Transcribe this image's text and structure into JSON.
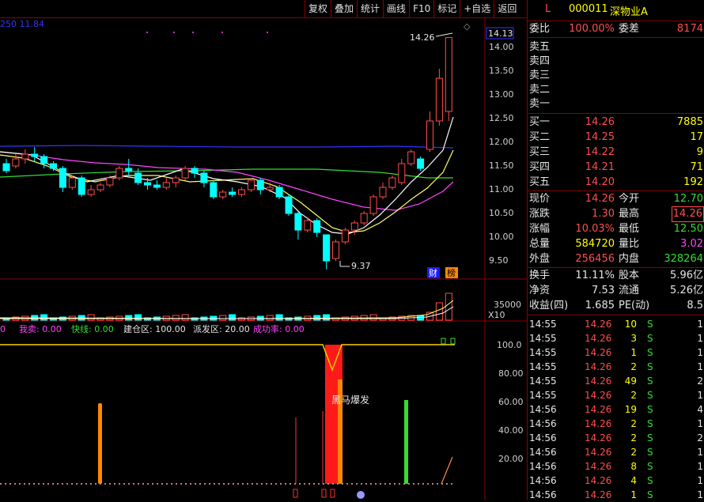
{
  "toolbar": {
    "buttons": [
      "复权",
      "叠加",
      "统计",
      "画线",
      "F10",
      "标记",
      "+自选",
      "返回"
    ]
  },
  "main_chart": {
    "ma_label": "250  11.84",
    "price_labels": [
      "14.00",
      "13.50",
      "13.00",
      "12.50",
      "12.00",
      "11.50",
      "11.00",
      "10.50",
      "10.00",
      "9.50"
    ],
    "current_price_tag": "14.13",
    "high_annotation": "14.26",
    "low_annotation": "9.37",
    "badge_cai": "财",
    "badge_bang": "榜"
  },
  "volume": {
    "label": "35000",
    "multiplier": "X10"
  },
  "indicator": {
    "labels": [
      {
        "text": "我卖: 0.00",
        "color": "#ff44ff"
      },
      {
        "text": "快线: 0.00",
        "color": "#33dd33"
      },
      {
        "text": "建仓区: 100.00",
        "color": "#e6e6e6"
      },
      {
        "text": "派发区: 20.00",
        "color": "#e6e6e6"
      },
      {
        "text": "成功率: 0.00",
        "color": "#ff44ff"
      }
    ],
    "left_stub": "0",
    "y_labels": [
      "100.0",
      "80.00",
      "60.00",
      "40.00",
      "20.00"
    ],
    "annotation": "黑马爆发"
  },
  "stock": {
    "marker": "L",
    "code": "000011",
    "name": "深物业A"
  },
  "order_book": {
    "weibi_label": "委比",
    "weibi_value": "100.00%",
    "weicha_label": "委差",
    "weicha_value": "8174",
    "asks": [
      {
        "label": "卖五"
      },
      {
        "label": "卖四"
      },
      {
        "label": "卖三"
      },
      {
        "label": "卖二"
      },
      {
        "label": "卖一"
      }
    ],
    "bids": [
      {
        "label": "买一",
        "price": "14.26",
        "vol": "7885"
      },
      {
        "label": "买二",
        "price": "14.25",
        "vol": "17"
      },
      {
        "label": "买三",
        "price": "14.22",
        "vol": "9"
      },
      {
        "label": "买四",
        "price": "14.21",
        "vol": "71"
      },
      {
        "label": "买五",
        "price": "14.20",
        "vol": "192"
      }
    ]
  },
  "quote": [
    {
      "l1": "现价",
      "v1": "14.26",
      "l2": "今开",
      "v2": "12.70",
      "c1": "red",
      "c2": "green"
    },
    {
      "l1": "涨跌",
      "v1": "1.30",
      "l2": "最高",
      "v2": "14.26",
      "c1": "red",
      "c2": "red",
      "box2": true
    },
    {
      "l1": "涨幅",
      "v1": "10.03%",
      "l2": "最低",
      "v2": "12.50",
      "c1": "red",
      "c2": "green"
    },
    {
      "l1": "总量",
      "v1": "584720",
      "l2": "量比",
      "v2": "3.02",
      "c1": "yellow",
      "c2": "magenta"
    },
    {
      "l1": "外盘",
      "v1": "256456",
      "l2": "内盘",
      "v2": "328264",
      "c1": "red",
      "c2": "green"
    }
  ],
  "fundamentals": [
    {
      "l1": "换手",
      "v1": "11.11%",
      "l2": "股本",
      "v2": "5.96亿"
    },
    {
      "l1": "净资",
      "v1": "7.53",
      "l2": "流通",
      "v2": "5.26亿"
    },
    {
      "l1": "收益(四)",
      "v1": "1.685",
      "l2": "PE(动)",
      "v2": "8.5"
    }
  ],
  "ticks": [
    {
      "time": "14:55",
      "price": "14.26",
      "vol": "10",
      "side": "S",
      "n": "1"
    },
    {
      "time": "14:55",
      "price": "14.26",
      "vol": "3",
      "side": "S",
      "n": "1"
    },
    {
      "time": "14:55",
      "price": "14.26",
      "vol": "1",
      "side": "S",
      "n": "1"
    },
    {
      "time": "14:55",
      "price": "14.26",
      "vol": "2",
      "side": "S",
      "n": "1"
    },
    {
      "time": "14:55",
      "price": "14.26",
      "vol": "49",
      "side": "S",
      "n": "2"
    },
    {
      "time": "14:55",
      "price": "14.26",
      "vol": "2",
      "side": "S",
      "n": "1"
    },
    {
      "time": "14:56",
      "price": "14.26",
      "vol": "19",
      "side": "S",
      "n": "4"
    },
    {
      "time": "14:56",
      "price": "14.26",
      "vol": "2",
      "side": "S",
      "n": "1"
    },
    {
      "time": "14:56",
      "price": "14.26",
      "vol": "2",
      "side": "S",
      "n": "2"
    },
    {
      "time": "14:56",
      "price": "14.26",
      "vol": "2",
      "side": "S",
      "n": "1"
    },
    {
      "time": "14:56",
      "price": "14.26",
      "vol": "8",
      "side": "S",
      "n": "1"
    },
    {
      "time": "14:56",
      "price": "14.26",
      "vol": "4",
      "side": "S",
      "n": "1"
    },
    {
      "time": "14:56",
      "price": "14.26",
      "vol": "1",
      "side": "S",
      "n": "1"
    }
  ],
  "colors": {
    "up": "#ff4d4d",
    "down": "#00ffff",
    "border": "#8b0000",
    "yellow": "#ffff00",
    "green": "#33dd33"
  }
}
